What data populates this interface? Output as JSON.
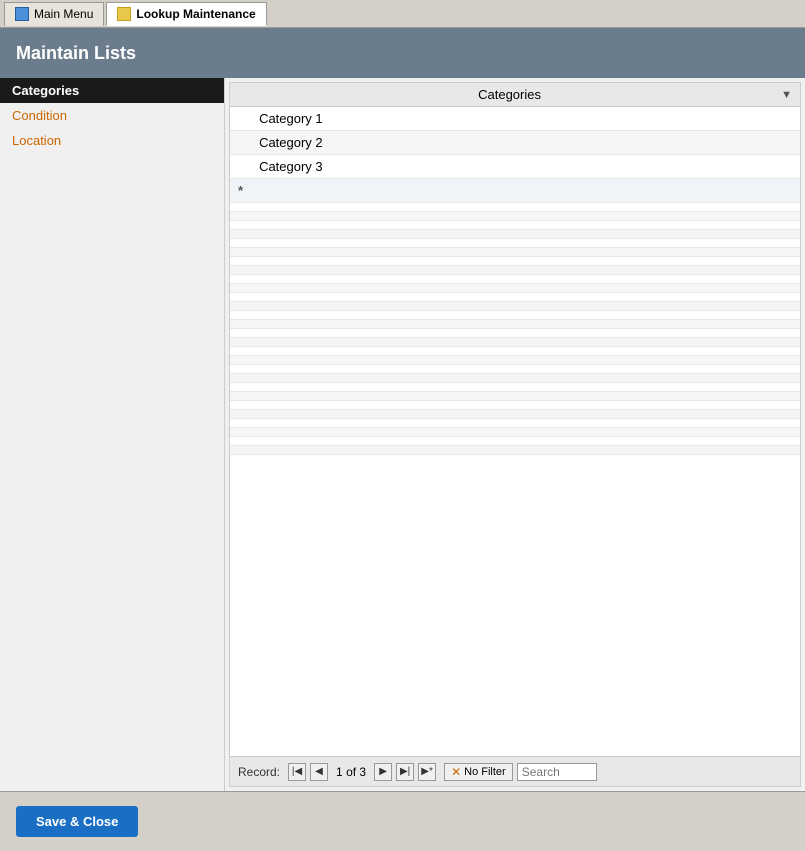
{
  "tabs": [
    {
      "id": "main-menu",
      "label": "Main Menu",
      "active": false
    },
    {
      "id": "lookup-maintenance",
      "label": "Lookup Maintenance",
      "active": true
    }
  ],
  "page_title": "Maintain Lists",
  "sidebar": {
    "items": [
      {
        "id": "categories",
        "label": "Categories",
        "selected": true,
        "style": "selected"
      },
      {
        "id": "condition",
        "label": "Condition",
        "style": "condition"
      },
      {
        "id": "location",
        "label": "Location",
        "style": "location"
      }
    ]
  },
  "table": {
    "header": "Categories",
    "columns": [
      "Categories"
    ],
    "rows": [
      {
        "id": 1,
        "value": "Category 1",
        "marker": ""
      },
      {
        "id": 2,
        "value": "Category 2",
        "marker": ""
      },
      {
        "id": 3,
        "value": "Category 3",
        "marker": ""
      }
    ],
    "new_row_marker": "*"
  },
  "navigation": {
    "record_label": "Record:",
    "current": "1",
    "total": "3",
    "of_label": "of",
    "no_filter_label": "No Filter",
    "search_placeholder": "Search"
  },
  "footer": {
    "save_close_label": "Save & Close"
  }
}
